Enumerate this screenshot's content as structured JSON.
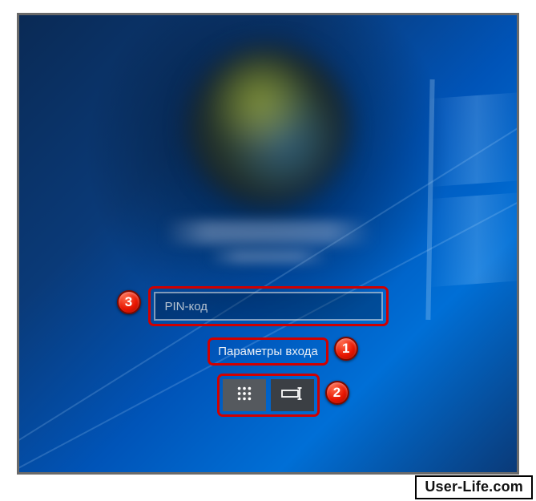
{
  "login": {
    "pin_placeholder": "PIN-код",
    "signin_options_label": "Параметры входа"
  },
  "annotations": {
    "badge1": "1",
    "badge2": "2",
    "badge3": "3"
  },
  "watermark": "User-Life.com",
  "icons": {
    "pin": "keypad-icon",
    "password": "password-icon"
  }
}
